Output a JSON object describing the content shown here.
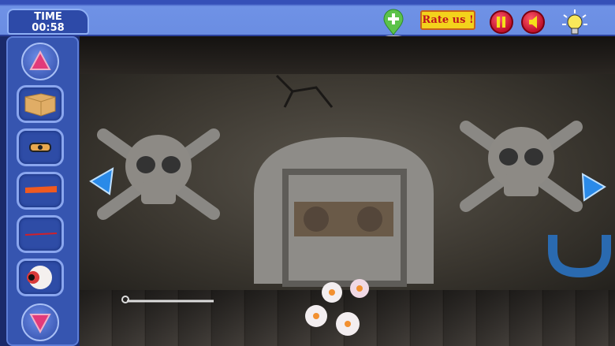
{
  "hud": {
    "time_label": "TIME",
    "time_value": "00:58",
    "rate_label": "Rate us !",
    "buttons": [
      "add-game-button",
      "pause-button",
      "sound-button",
      "hint-button"
    ]
  },
  "inventory": {
    "items": [
      "cardboard-box",
      "eye-slot-piece",
      "orange-stick",
      "red-rod",
      "eyeball"
    ]
  },
  "colors": {
    "bar": "#6a8de2",
    "panel": "#3655b0",
    "rate_bg": "#f3d21c",
    "rate_text": "#c0141c"
  }
}
